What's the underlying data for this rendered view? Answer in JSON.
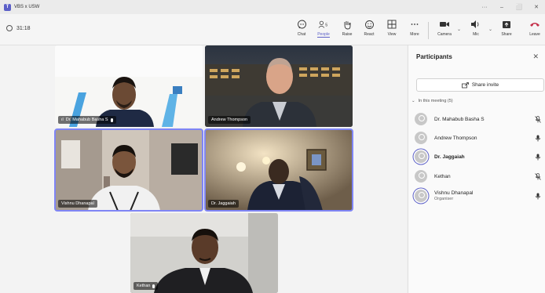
{
  "window": {
    "title": "VBS x USW",
    "controls": [
      "···",
      "–",
      "⬜",
      "✕"
    ]
  },
  "toolbar": {
    "timer": "31:18",
    "buttons": [
      {
        "label": "Chat",
        "icon": "chat-icon"
      },
      {
        "label": "People",
        "icon": "people-icon",
        "active": true,
        "badge": "5"
      },
      {
        "label": "Raise",
        "icon": "raise-hand-icon"
      },
      {
        "label": "React",
        "icon": "react-icon"
      },
      {
        "label": "View",
        "icon": "view-icon"
      },
      {
        "label": "More",
        "icon": "more-icon"
      },
      {
        "label": "Camera",
        "icon": "camera-icon"
      },
      {
        "label": "Mic",
        "icon": "mic-icon"
      },
      {
        "label": "Share",
        "icon": "share-icon"
      },
      {
        "label": "Leave",
        "icon": "leave-icon"
      }
    ]
  },
  "tiles": [
    {
      "name": "Dr. Mahabub Basha S",
      "prefix": "ıl",
      "muted": true
    },
    {
      "name": "Andrew Thompson"
    },
    {
      "name": "Vishnu Dhanapal"
    },
    {
      "name": "Dr. Jaggaiah"
    },
    {
      "name": "Kethan",
      "muted": true
    }
  ],
  "panel": {
    "title": "Participants",
    "share_invite": "Share invite",
    "section": "In this meeting (5)",
    "participants": [
      {
        "name": "Dr. Mahabub Basha S",
        "mic": "muted"
      },
      {
        "name": "Andrew Thompson",
        "mic": "on"
      },
      {
        "name": "Dr. Jaggaiah",
        "mic": "on",
        "bold": true
      },
      {
        "name": "Kethan",
        "mic": "muted"
      },
      {
        "name": "Vishnu Dhanapal",
        "sub": "Organiser",
        "mic": "on"
      }
    ]
  },
  "colors": {
    "accent": "#5b5fc7",
    "leave": "#c4314b"
  }
}
